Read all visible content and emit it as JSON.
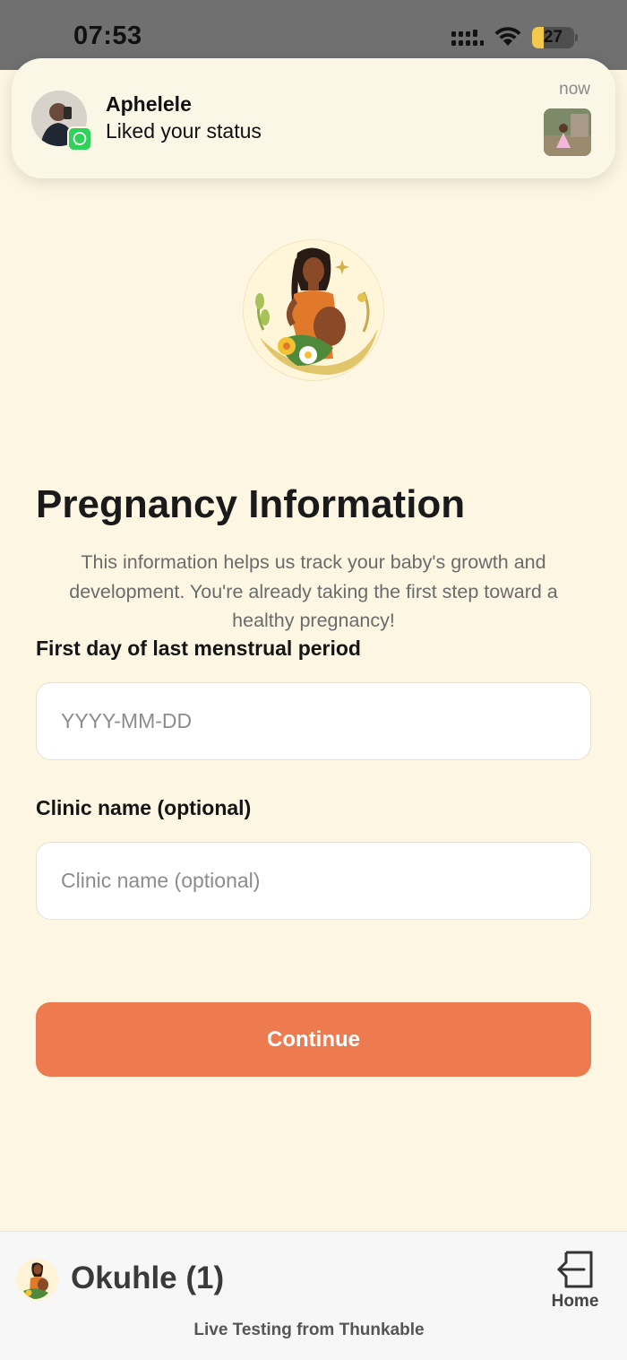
{
  "status_bar": {
    "time": "07:53",
    "battery_level": "27",
    "battery_fraction": 0.27,
    "icons": [
      "signal-icon",
      "wifi-icon",
      "battery-icon"
    ]
  },
  "notification": {
    "sender": "Aphelele",
    "message": "Liked your status",
    "time": "now",
    "app_icon": "whatsapp-icon",
    "app_color": "#2fd158"
  },
  "form": {
    "title": "Pregnancy Information",
    "description": "This information helps us track your baby's growth and development. You're already taking the first step toward a healthy pregnancy!",
    "lmp": {
      "label": "First day of last menstrual period",
      "placeholder": "YYYY-MM-DD",
      "value": ""
    },
    "clinic": {
      "label": "Clinic name (optional)",
      "placeholder": "Clinic name (optional)",
      "value": ""
    },
    "continue_label": "Continue"
  },
  "bottom_bar": {
    "project_name": "Okuhle (1)",
    "home_label": "Home",
    "footer": "Live Testing from Thunkable",
    "home_icon": "exit-icon"
  },
  "colors": {
    "background": "#fcf6e2",
    "accent": "#ee7a50",
    "status_bar": "#707070"
  }
}
